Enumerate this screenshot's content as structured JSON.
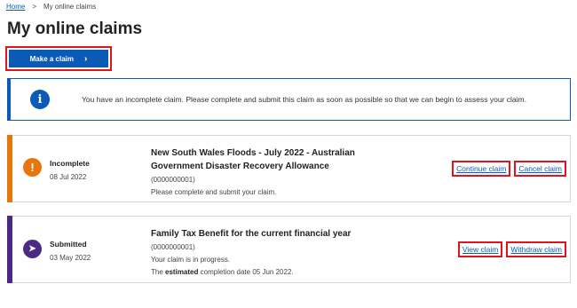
{
  "breadcrumb": {
    "home": "Home",
    "separator": ">",
    "current": "My online claims"
  },
  "page": {
    "title": "My online claims"
  },
  "make_claim": {
    "label": "Make a claim",
    "icon": "chevron-right-icon",
    "chevron": "›"
  },
  "info": {
    "icon": "info-icon",
    "glyph": "i",
    "text": "You have an incomplete claim. Please complete and submit this claim as soon as possible so that we can begin to assess your claim."
  },
  "claims": [
    {
      "status": "Incomplete",
      "status_color": "#e8740c",
      "status_icon": "exclamation-icon",
      "status_glyph": "!",
      "date": "08 Jul 2022",
      "title": "New South Wales Floods - July 2022 - Australian Government Disaster Recovery Allowance",
      "reference": "(0000000001)",
      "message": "Please complete and submit your claim.",
      "actions": [
        "Continue claim",
        "Cancel claim"
      ]
    },
    {
      "status": "Submitted",
      "status_color": "#4b2a85",
      "status_icon": "paper-plane-icon",
      "status_glyph": "➤",
      "date": "03 May 2022",
      "title": "Family Tax Benefit for the current financial year",
      "reference": "(0000000001)",
      "message": "Your claim is in progress.",
      "completion_prefix": "The",
      "completion_bold": "estimated",
      "completion_suffix": "completion date 05 Jun 2022.",
      "actions": [
        "View claim",
        "Withdraw claim"
      ]
    }
  ]
}
